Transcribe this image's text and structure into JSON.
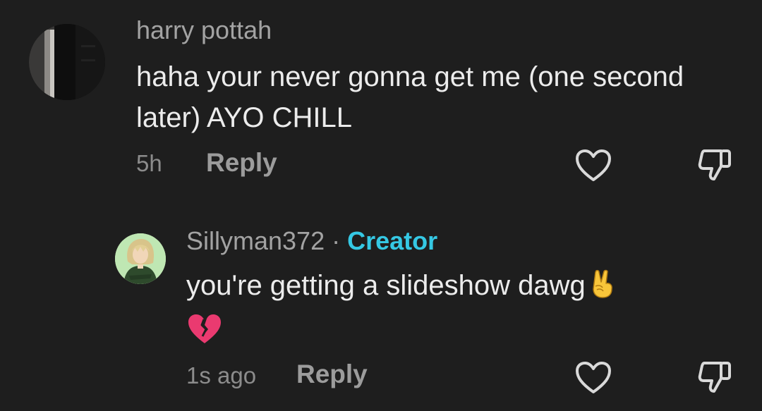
{
  "comments": [
    {
      "avatar_icon": "dark-photo-avatar",
      "username": "harry pottah",
      "text": "haha your never gonna get me (one second later) AYO CHILL",
      "time": "5h",
      "reply_label": "Reply",
      "like_icon": "heart-outline-icon",
      "dislike_icon": "thumbs-down-outline-icon"
    },
    {
      "avatar_icon": "anime-character-avatar",
      "username": "Sillyman372",
      "separator": "·",
      "badge": "Creator",
      "text": "you're getting a slideshow dawg",
      "emoji_1": "victory-hand-emoji",
      "emoji_2": "broken-heart-emoji",
      "time": "1s ago",
      "reply_label": "Reply",
      "like_icon": "heart-outline-icon",
      "dislike_icon": "thumbs-down-outline-icon"
    }
  ],
  "colors": {
    "background": "#1e1e1e",
    "username": "#a3a3a3",
    "body_text": "#ececec",
    "meta_text": "#8c8c8c",
    "creator_badge": "#35c8e4"
  }
}
